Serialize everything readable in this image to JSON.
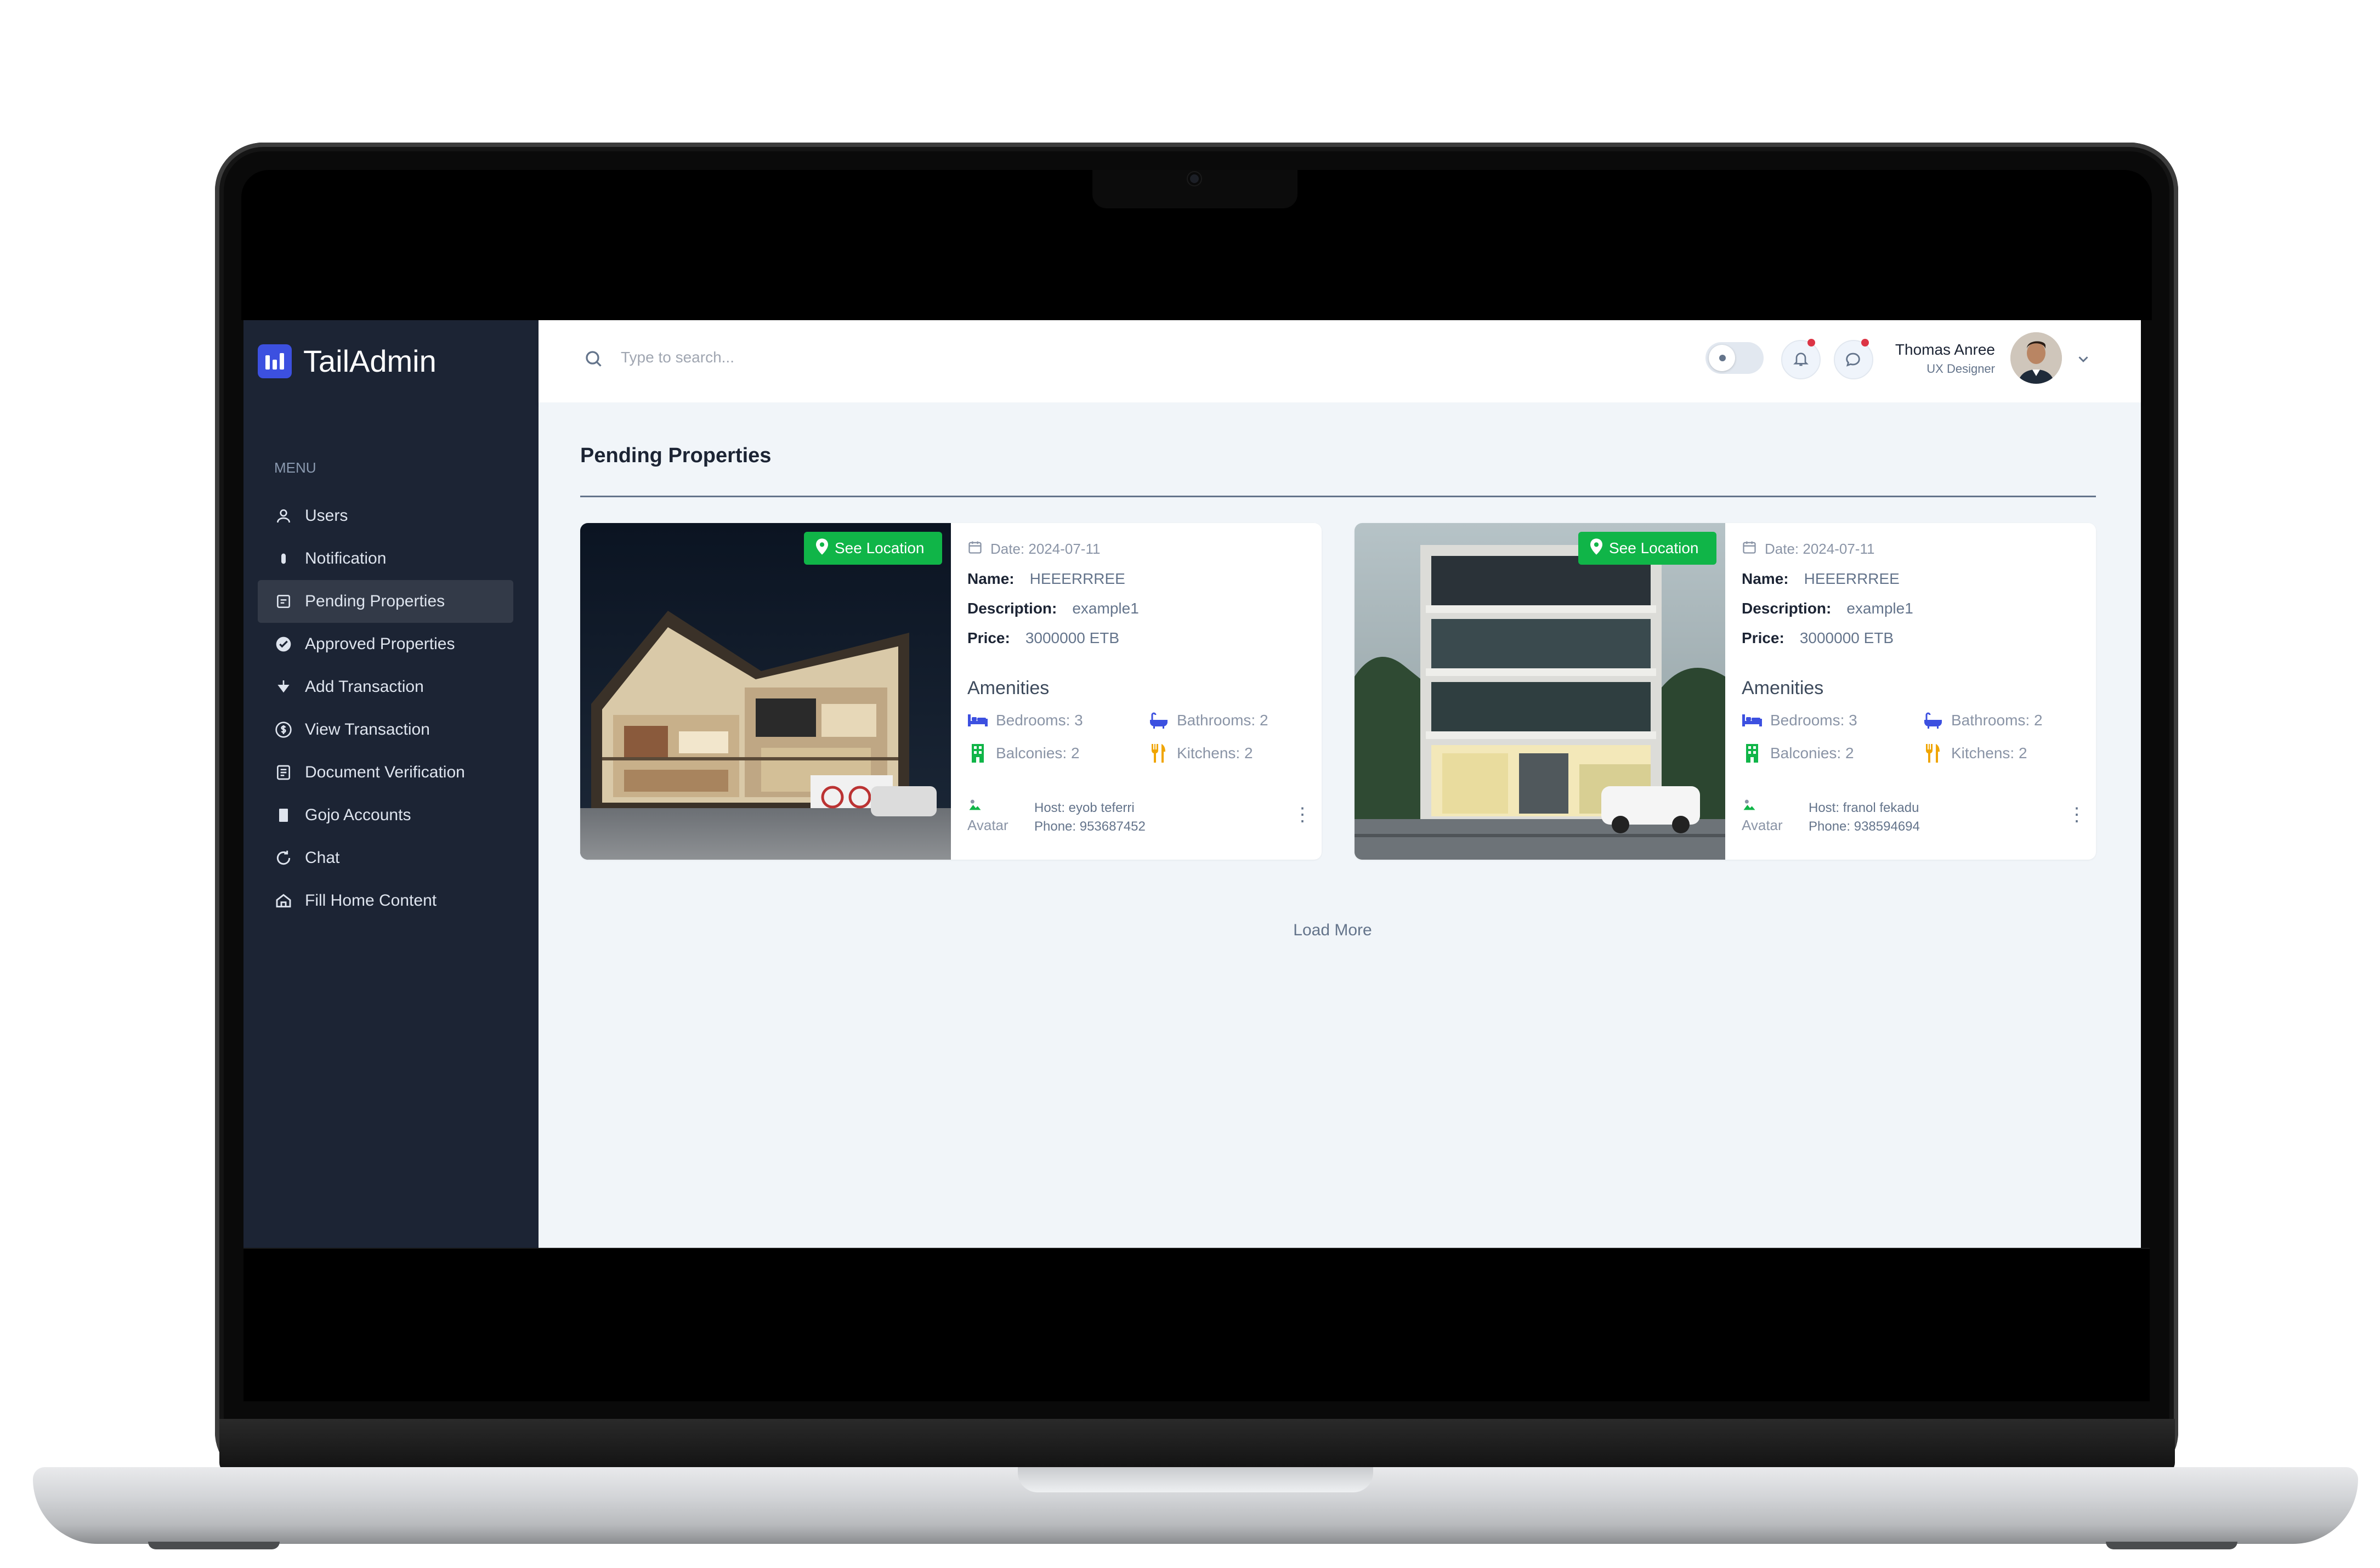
{
  "sidebar": {
    "brand": "TailAdmin",
    "menu_label": "MENU",
    "items": [
      {
        "label": "Users",
        "icon": "user-icon",
        "active": false
      },
      {
        "label": "Notification",
        "icon": "bell-icon",
        "active": false
      },
      {
        "label": "Pending Properties",
        "icon": "form-icon",
        "active": true
      },
      {
        "label": "Approved Properties",
        "icon": "check-circle-icon",
        "active": false
      },
      {
        "label": "Add Transaction",
        "icon": "arrow-down-icon",
        "active": false
      },
      {
        "label": "View Transaction",
        "icon": "dollar-circle-icon",
        "active": false
      },
      {
        "label": "Document Verification",
        "icon": "document-icon",
        "active": false
      },
      {
        "label": "Gojo Accounts",
        "icon": "book-icon",
        "active": false
      },
      {
        "label": "Chat",
        "icon": "refresh-icon",
        "active": false
      },
      {
        "label": "Fill Home Content",
        "icon": "home-icon",
        "active": false
      }
    ]
  },
  "header": {
    "search_placeholder": "Type to search...",
    "user_name": "Thomas Anree",
    "user_role": "UX Designer"
  },
  "main": {
    "title": "Pending Properties",
    "load_more": "Load More",
    "cards": [
      {
        "badge": "See Location",
        "date": "Date: 2024-07-11",
        "name_label": "Name:",
        "name": "HEEERRREE",
        "description_label": "Description:",
        "description": "example1",
        "price_label": "Price:",
        "price": "3000000 ETB",
        "amenities_title": "Amenities",
        "bedrooms": "Bedrooms: 3",
        "bathrooms": "Bathrooms: 2",
        "balconies": "Balconies: 2",
        "kitchens": "Kitchens: 2",
        "avatar_alt": "Avatar",
        "host": "Host: eyob teferri",
        "phone": "Phone: 953687452"
      },
      {
        "badge": "See Location",
        "date": "Date: 2024-07-11",
        "name_label": "Name:",
        "name": "HEEERRREE",
        "description_label": "Description:",
        "description": "example1",
        "price_label": "Price:",
        "price": "3000000 ETB",
        "amenities_title": "Amenities",
        "bedrooms": "Bedrooms: 3",
        "bathrooms": "Bathrooms: 2",
        "balconies": "Balconies: 2",
        "kitchens": "Kitchens: 2",
        "avatar_alt": "Avatar",
        "host": "Host: franol fekadu",
        "phone": "Phone: 938594694"
      }
    ]
  },
  "colors": {
    "sidebar_bg": "#1c2434",
    "brand_accent": "#3c50e0",
    "badge_green": "#10b548",
    "main_bg": "#f1f5f9",
    "notification_dot": "#dc3545"
  }
}
